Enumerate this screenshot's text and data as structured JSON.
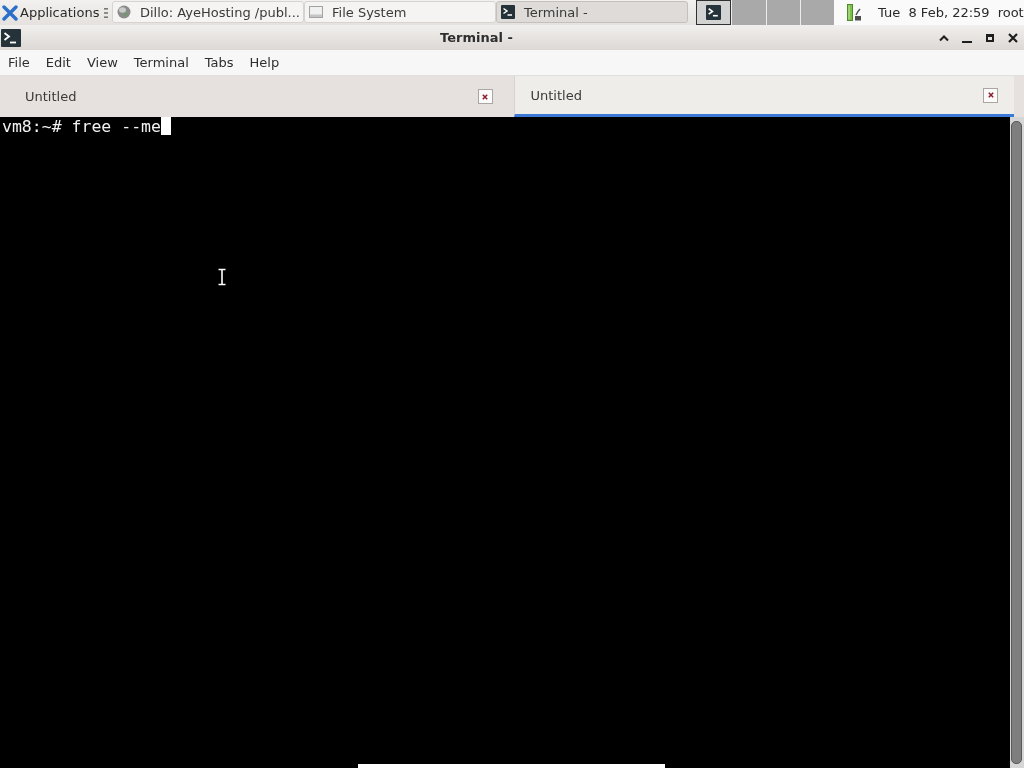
{
  "panel": {
    "applications": "Applications",
    "tasks": [
      {
        "label": "Dillo: AyeHosting /publ...",
        "kind": "browser",
        "selected": false
      },
      {
        "label": "File System",
        "kind": "drive",
        "selected": false
      },
      {
        "label": "Terminal -",
        "kind": "terminal",
        "selected": true
      }
    ],
    "workspaces": [
      {
        "selected": true,
        "windows": [
          {
            "kind": "terminal"
          }
        ]
      },
      {
        "selected": false
      },
      {
        "selected": false
      },
      {
        "selected": false
      }
    ],
    "clock": "Tue  8 Feb, 22:59",
    "user": "root"
  },
  "window": {
    "title": "Terminal -"
  },
  "menu": [
    "File",
    "Edit",
    "View",
    "Terminal",
    "Tabs",
    "Help"
  ],
  "tabs": [
    {
      "label": "Untitled",
      "selected": false
    },
    {
      "label": "Untitled",
      "selected": true
    }
  ],
  "terminal": {
    "lines": [
      "vm8:~# free --me"
    ],
    "cursor_visible": true
  }
}
